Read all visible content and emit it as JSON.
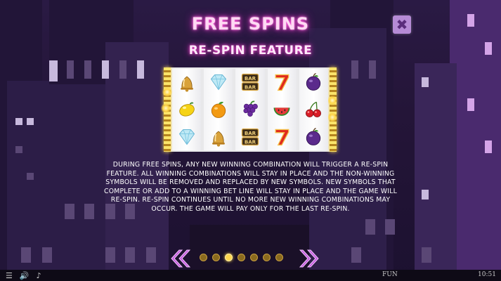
{
  "screen": {
    "title": "FREE SPINS",
    "subtitle": "RE-SPIN FEATURE",
    "close_icon": "close-x-icon"
  },
  "reels": [
    [
      "bell",
      "lemon",
      "diamond"
    ],
    [
      "diamond",
      "orange",
      "bell"
    ],
    [
      "bar-bar",
      "grapes",
      "bar-bar"
    ],
    [
      "seven",
      "watermelon",
      "seven"
    ],
    [
      "plum",
      "cherries",
      "plum"
    ]
  ],
  "description": "DURING FREE SPINS, ANY NEW WINNING COMBINATION WILL TRIGGER A RE-SPIN FEATURE. ALL WINNING COMBINATIONS WILL STAY IN PLACE AND THE NON-WINNING SYMBOLS WILL BE REMOVED AND REPLACED BY NEW SYMBOLS. NEW SYMBOLS THAT COMPLETE OR ADD TO A WINNING BET LINE WILL STAY IN PLACE AND THE GAME WILL RE-SPIN. RE-SPIN CONTINUES UNTIL NO MORE NEW WINNING COMBINATIONS MAY OCCUR. THE GAME WILL PAY ONLY FOR THE LAST RE-SPIN.",
  "pagination": {
    "pages": 7,
    "current": 3
  },
  "bottom_bar": {
    "menu_icon": "menu-icon",
    "sound_icon": "speaker-icon",
    "music_icon": "music-note-icon",
    "mode": "FUN",
    "time": "10:51"
  },
  "colors": {
    "title_glow": "#ff4fd8",
    "accent_gold": "#ffd650",
    "arrow_purple": "#c65de0"
  }
}
